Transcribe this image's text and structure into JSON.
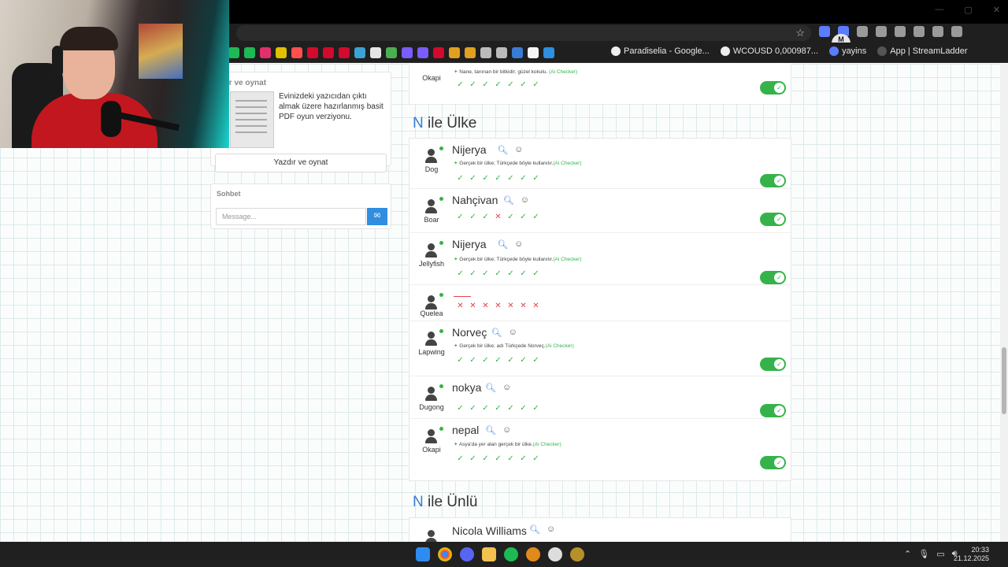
{
  "browser": {
    "bookmarks": [
      {
        "label": "Paradiselia - Google..."
      },
      {
        "label": "WCOUSD 0,000987..."
      },
      {
        "label": "yayins"
      },
      {
        "label": "App | StreamLadder"
      }
    ]
  },
  "sidebar": {
    "card_title": "ır ve oynat",
    "description": "Evinizdeki yazıcıdan çıktı almak üzere hazırlanmış basit PDF oyun verziyonu.",
    "print_button": "Yazdır ve oynat",
    "chat_title": "Sohbet",
    "chat_placeholder": "Message..."
  },
  "top_entry": {
    "player": "Okapi",
    "note": "Nane, tanınan bir bitkidir; güzel kokulu.",
    "ai_label": "(Ai Checker)",
    "votes": [
      "ok",
      "ok",
      "ok",
      "ok",
      "ok",
      "ok",
      "ok"
    ],
    "enabled": true
  },
  "section_ulke": {
    "letter": "N",
    "title": "ile Ülke"
  },
  "ulke_entries": [
    {
      "player": "Dog",
      "answer": "Nijerya",
      "note": "Gerçek bir ülke; Türkçede böyle kullanılır.",
      "ai_label": "(Ai Checker)",
      "votes": [
        "ok",
        "ok",
        "ok",
        "ok",
        "ok",
        "ok",
        "ok"
      ],
      "enabled": true
    },
    {
      "player": "Boar",
      "answer": "Nahçivan",
      "note": "",
      "ai_label": "",
      "votes": [
        "ok",
        "ok",
        "ok",
        "no",
        "ok",
        "ok",
        "ok"
      ],
      "enabled": true
    },
    {
      "player": "Jellyfish",
      "answer": "Nijerya",
      "note": "Gerçek bir ülke; Türkçede böyle kullanılır.",
      "ai_label": "(Ai Checker)",
      "votes": [
        "ok",
        "ok",
        "ok",
        "ok",
        "ok",
        "ok",
        "ok"
      ],
      "enabled": true
    },
    {
      "player": "Quelea",
      "answer": "",
      "note": "",
      "ai_label": "",
      "votes": [
        "no",
        "no",
        "no",
        "no",
        "no",
        "no",
        "no"
      ],
      "enabled": false
    },
    {
      "player": "Lapwing",
      "answer": "Norveç",
      "note": "Gerçek bir ülke; adı Türkçede Norveç.",
      "ai_label": "(Ai Checker)",
      "votes": [
        "ok",
        "ok",
        "ok",
        "ok",
        "ok",
        "ok",
        "ok"
      ],
      "enabled": true
    },
    {
      "player": "Dugong",
      "answer": "nokya",
      "note": "",
      "ai_label": "",
      "votes": [
        "ok",
        "ok",
        "ok",
        "ok",
        "ok",
        "ok",
        "ok"
      ],
      "enabled": true
    },
    {
      "player": "Okapi",
      "answer": "nepal",
      "note": "Asya'da yer alan gerçek bir ülke.",
      "ai_label": "(Ai Checker)",
      "votes": [
        "ok",
        "ok",
        "ok",
        "ok",
        "ok",
        "ok",
        "ok"
      ],
      "enabled": true
    }
  ],
  "section_unlu": {
    "letter": "N",
    "title": "ile Ünlü"
  },
  "unlu_entry": {
    "answer": "Nicola Williams"
  },
  "taskbar": {
    "time": "20:33",
    "date": "21.12.2025"
  },
  "colors": {
    "accent": "#3a7bd5",
    "ok": "#35b34a",
    "no": "#e2434b"
  }
}
